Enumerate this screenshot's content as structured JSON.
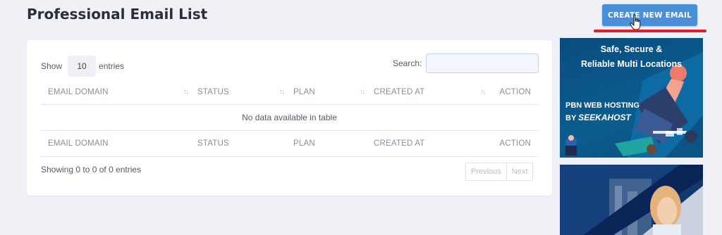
{
  "page": {
    "title": "Professional Email List",
    "create_button": "CREATE NEW EMAIL"
  },
  "table_controls": {
    "show_label": "Show",
    "entries_value": "10",
    "entries_label": "entries",
    "search_label": "Search:",
    "search_value": ""
  },
  "columns": [
    "EMAIL DOMAIN",
    "STATUS",
    "PLAN",
    "CREATED AT",
    "ACTION"
  ],
  "empty_message": "No data available in table",
  "footer": {
    "info": "Showing 0 to 0 of 0 entries",
    "previous": "Previous",
    "next": "Next"
  },
  "ad": {
    "headline_1": "Safe, Secure &",
    "headline_2": "Reliable Multi Locations",
    "sub_1": "PBN WEB HOSTING",
    "sub_by": "BY",
    "brand": "SEEKAHOST"
  },
  "colors": {
    "primary_button": "#4a90d9",
    "highlight_underline": "#e0202a",
    "page_background": "#f0f1f6"
  }
}
